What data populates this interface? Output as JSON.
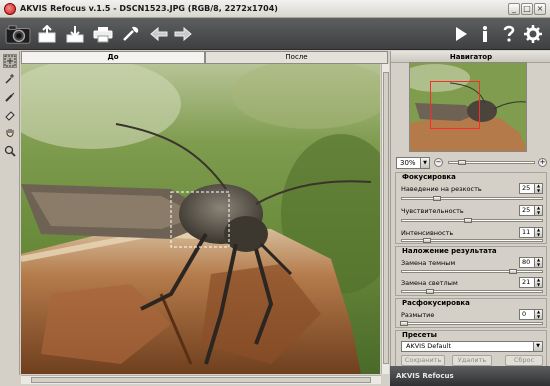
{
  "window": {
    "title": "AKVIS Refocus v.1.5 - DSCN1523.JPG (RGB/8, 2272x1704)"
  },
  "toolbar": {
    "icons": [
      "camera-icon",
      "open-icon",
      "save-icon",
      "print-icon",
      "settings-wand-icon",
      "undo-icon",
      "redo-icon",
      "run-icon",
      "info-icon",
      "help-icon",
      "preferences-icon"
    ]
  },
  "tabs": {
    "before": "До",
    "after": "После"
  },
  "navigator": {
    "title": "Навигатор",
    "zoom": "30%",
    "zoom_minus": "−",
    "zoom_plus": "+"
  },
  "focusing": {
    "title": "Фокусировка",
    "params": [
      {
        "label": "Наведение на резкость",
        "value": "25",
        "fraction": 0.25
      },
      {
        "label": "Чувствительность",
        "value": "25",
        "fraction": 0.5
      },
      {
        "label": "Интенсивность",
        "value": "11",
        "fraction": 0.18
      }
    ]
  },
  "overlay": {
    "title": "Наложение результата",
    "params": [
      {
        "label": "Замена темным",
        "value": "80",
        "fraction": 0.8
      },
      {
        "label": "Замена светлым",
        "value": "21",
        "fraction": 0.21
      }
    ]
  },
  "defocus": {
    "title": "Расфокусировка",
    "params": [
      {
        "label": "Размытие",
        "value": "0",
        "fraction": 0.0
      }
    ]
  },
  "presets": {
    "title": "Пресеты",
    "selected": "AKVIS Default",
    "save": "Сохранить",
    "delete": "Удалить",
    "reset": "Сброс"
  },
  "status": {
    "text": "AKVIS Refocus"
  }
}
